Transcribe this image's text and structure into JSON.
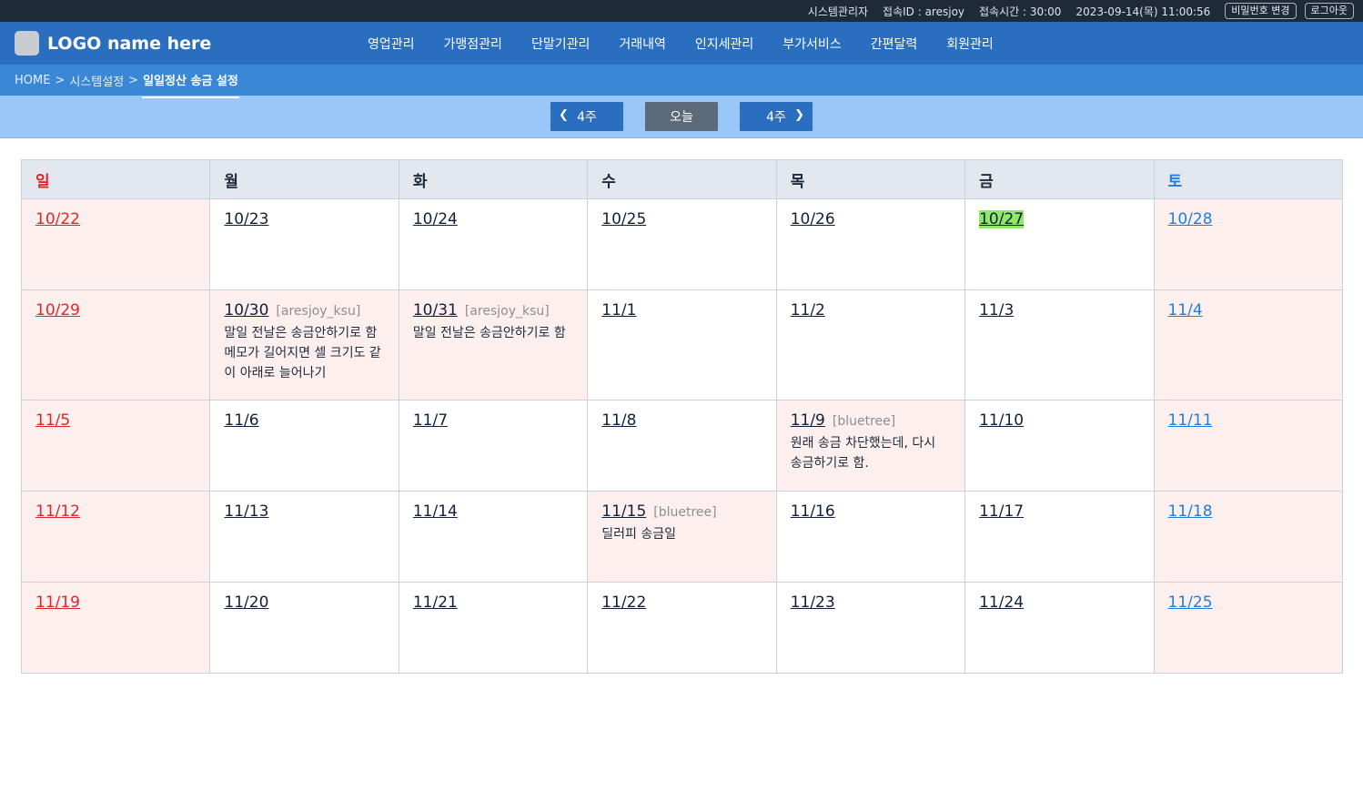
{
  "topbar": {
    "role": "시스템관리자",
    "login_id": "접속ID : aresjoy",
    "session_time": "접속시간 : 30:00",
    "datetime": "2023-09-14(목) 11:00:56",
    "change_password": "비밀번호 변경",
    "logout": "로그아웃"
  },
  "header": {
    "logo": "LOGO name here",
    "menu": [
      "영업관리",
      "가맹점관리",
      "단말기관리",
      "거래내역",
      "인지세관리",
      "부가서비스",
      "간편달력",
      "회원관리"
    ]
  },
  "breadcrumb": {
    "home": "HOME",
    "section": "시스템설정",
    "current": "일일정산 송금 설정",
    "separator": ">"
  },
  "week_nav": {
    "prev": "4주",
    "today": "오늘",
    "next": "4주"
  },
  "calendar": {
    "weekdays": [
      "일",
      "월",
      "화",
      "수",
      "목",
      "금",
      "토"
    ],
    "weeks": [
      [
        {
          "date": "10/22"
        },
        {
          "date": "10/23"
        },
        {
          "date": "10/24"
        },
        {
          "date": "10/25"
        },
        {
          "date": "10/26"
        },
        {
          "date": "10/27",
          "today": true
        },
        {
          "date": "10/28"
        }
      ],
      [
        {
          "date": "10/29"
        },
        {
          "date": "10/30",
          "author": "[aresjoy_ksu]",
          "note": "말일 전날은 송금안하기로 함 메모가 길어지면 셀 크기도 같이 아래로 늘어나기"
        },
        {
          "date": "10/31",
          "author": "[aresjoy_ksu]",
          "note": "말일 전날은 송금안하기로 함"
        },
        {
          "date": "11/1"
        },
        {
          "date": "11/2"
        },
        {
          "date": "11/3"
        },
        {
          "date": "11/4"
        }
      ],
      [
        {
          "date": "11/5"
        },
        {
          "date": "11/6"
        },
        {
          "date": "11/7"
        },
        {
          "date": "11/8"
        },
        {
          "date": "11/9",
          "author": "[bluetree]",
          "note": "원래 송금 차단했는데, 다시 송금하기로 함."
        },
        {
          "date": "11/10"
        },
        {
          "date": "11/11"
        }
      ],
      [
        {
          "date": "11/12"
        },
        {
          "date": "11/13"
        },
        {
          "date": "11/14"
        },
        {
          "date": "11/15",
          "author": "[bluetree]",
          "note": "딜러피 송금일",
          "memo": true
        },
        {
          "date": "11/16"
        },
        {
          "date": "11/17"
        },
        {
          "date": "11/18"
        }
      ],
      [
        {
          "date": "11/19"
        },
        {
          "date": "11/20"
        },
        {
          "date": "11/21"
        },
        {
          "date": "11/22"
        },
        {
          "date": "11/23"
        },
        {
          "date": "11/24"
        },
        {
          "date": "11/25"
        }
      ]
    ]
  },
  "colors": {
    "topbar": "#1f2a38",
    "navbar": "#2a6fbf",
    "breadcrumb_bar": "#3a87d6",
    "week_bar": "#99c8f8",
    "sunday": "#e0262b",
    "saturday": "#1e7fe0",
    "memo_bg": "#fdefee",
    "today_highlight": "#8ee86b"
  }
}
